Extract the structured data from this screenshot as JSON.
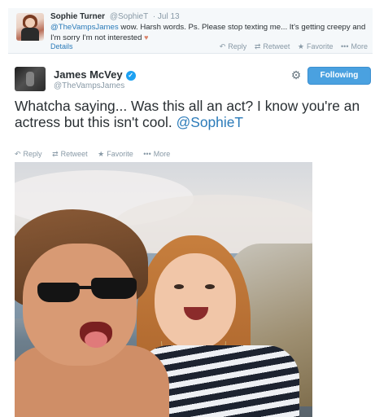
{
  "reply_tweet": {
    "name": "Sophie Turner",
    "handle": "@SophieT",
    "date": "· Jul 13",
    "mention": "@TheVampsJames",
    "text": " wow. Harsh words. Ps. Please stop texting me... It's getting creepy and I'm sorry I'm not interested",
    "emoji": "♥",
    "details_label": "Details",
    "actions": {
      "reply": "Reply",
      "retweet": "Retweet",
      "favorite": "Favorite",
      "more": "More"
    }
  },
  "main_tweet": {
    "name": "James McVey",
    "handle": "@TheVampsJames",
    "follow_button": "Following",
    "text": "Whatcha saying... Was this all an act? I know you're an actress but this isn't cool. ",
    "mention": "@SophieT",
    "actions": {
      "reply": "Reply",
      "retweet": "Retweet",
      "favorite": "Favorite",
      "more": "More"
    }
  },
  "icons": {
    "reply": "reply-icon",
    "retweet": "retweet-icon",
    "favorite": "star-icon",
    "more": "more-icon",
    "settings": "gear-icon",
    "verified": "verified-badge-icon"
  },
  "colors": {
    "link": "#2b7bb9",
    "follow_button": "#4aa1e0",
    "muted": "#8899a6"
  }
}
